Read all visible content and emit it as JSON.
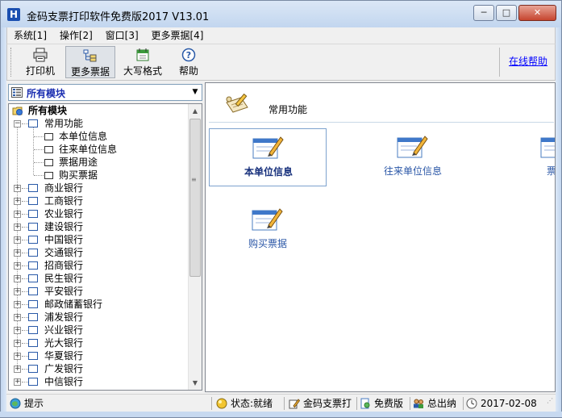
{
  "window": {
    "app_icon_text": "H",
    "title": "金码支票打印软件免费版2017  V13.01",
    "minimize_glyph": "─",
    "maximize_glyph": "□",
    "close_glyph": "✕"
  },
  "menu": {
    "items": [
      {
        "label": "系统[1]"
      },
      {
        "label": "操作[2]"
      },
      {
        "label": "窗口[3]"
      },
      {
        "label": "更多票据[4]"
      }
    ]
  },
  "toolbar": {
    "print_label": "打印机",
    "more_label": "更多票据",
    "uppercase_label": "大写格式",
    "help_label": "帮助",
    "online_help_label": "在线帮助"
  },
  "module_selector": {
    "selected": "所有模块"
  },
  "tree": {
    "root": "所有模块",
    "common": {
      "label": "常用功能",
      "children": [
        "本单位信息",
        "往来单位信息",
        "票据用途",
        "购买票据"
      ]
    },
    "banks": [
      "商业银行",
      "工商银行",
      "农业银行",
      "建设银行",
      "中国银行",
      "交通银行",
      "招商银行",
      "民生银行",
      "平安银行",
      "邮政储蓄银行",
      "浦发银行",
      "兴业银行",
      "光大银行",
      "华夏银行",
      "广发银行",
      "中信银行"
    ],
    "expander_plus": "+",
    "expander_minus": "−"
  },
  "main": {
    "group_title": "常用功能",
    "items": [
      {
        "label": "本单位信息"
      },
      {
        "label": "往来单位信息"
      },
      {
        "label": "票据"
      },
      {
        "label": "购买票据"
      }
    ]
  },
  "statusbar": {
    "hint": "提示",
    "status": "状态:就绪",
    "product": "金码支票打",
    "edition": "免费版",
    "cashier": "总出纳",
    "date": "2017-02-08"
  },
  "colors": {
    "accent_link": "#0000ff",
    "selected_module_text": "#1a2db0",
    "item_text": "#2b57a7"
  }
}
